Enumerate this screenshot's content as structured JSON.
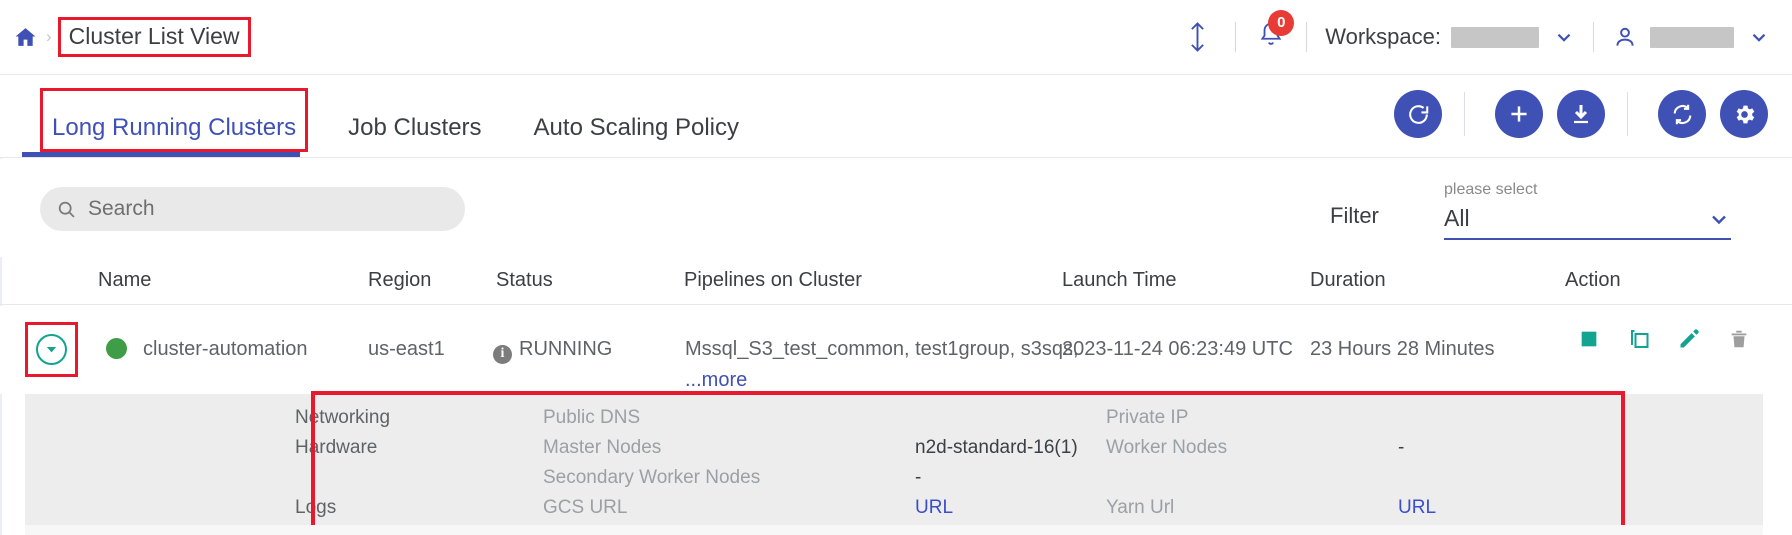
{
  "header": {
    "home_icon": "home-icon",
    "separator": "›",
    "breadcrumb_title": "Cluster List View",
    "sort_icon": "sort-vertical-icon",
    "bell_icon": "bell-icon",
    "notification_count": "0",
    "workspace_label": "Workspace:",
    "workspace_value": "",
    "user_icon": "user-icon",
    "user_value": "",
    "chevron_icon": "chevron-down-icon"
  },
  "tabs": [
    {
      "label": "Long Running Clusters",
      "active": true
    },
    {
      "label": "Job Clusters",
      "active": false
    },
    {
      "label": "Auto Scaling Policy",
      "active": false
    }
  ],
  "toolbar": {
    "buttons": [
      {
        "name": "restart-button",
        "icon": "restart-icon"
      },
      {
        "name": "add-button",
        "icon": "plus-icon"
      },
      {
        "name": "download-button",
        "icon": "download-icon"
      },
      {
        "name": "sync-button",
        "icon": "sync-icon"
      },
      {
        "name": "settings-button",
        "icon": "gear-icon"
      }
    ]
  },
  "search": {
    "icon": "search-icon",
    "placeholder": "Search",
    "value": ""
  },
  "filter": {
    "label": "Filter",
    "float_label": "please select",
    "selected": "All",
    "options": [
      "All"
    ],
    "chevron_icon": "chevron-down-icon"
  },
  "table": {
    "columns": [
      "Name",
      "Region",
      "Status",
      "Pipelines on Cluster",
      "Launch Time",
      "Duration",
      "Action"
    ],
    "rows": [
      {
        "expander_icon": "circle-chevron-down-icon",
        "status_dot": "green-status-dot",
        "name": "cluster-automation",
        "region": "us-east1",
        "status_icon": "info-icon",
        "status": "RUNNING",
        "pipelines": "Mssql_S3_test_common, test1group, s3sqs,",
        "pipelines_more": "...more",
        "launch_time": "2023-11-24 06:23:49 UTC",
        "duration": "23 Hours 28 Minutes",
        "actions": [
          {
            "name": "stop-button",
            "icon": "stop-square-icon"
          },
          {
            "name": "clone-button",
            "icon": "copy-icon"
          },
          {
            "name": "edit-button",
            "icon": "pencil-icon"
          },
          {
            "name": "delete-button",
            "icon": "trash-icon"
          }
        ]
      }
    ]
  },
  "detail_panel": {
    "rows": [
      {
        "section": "Networking",
        "label1": "Public DNS",
        "value1": "",
        "label2": "Private IP",
        "value2": ""
      },
      {
        "section": "Hardware",
        "label1": "Master Nodes",
        "value1": "n2d-standard-16(1)",
        "label2": "Worker Nodes",
        "value2": "-"
      },
      {
        "section": "",
        "label1": "Secondary Worker Nodes",
        "value1": "-",
        "label2": "",
        "value2": ""
      },
      {
        "section": "Logs",
        "label1": "GCS URL",
        "value1": "URL",
        "label2": "Yarn Url",
        "value2": "URL"
      }
    ]
  },
  "colors": {
    "primary": "#3f51b5",
    "annotation": "#e8192c",
    "teal": "#13a391",
    "status_green": "#3f9c47",
    "link": "#3b4ecc",
    "panel_bg": "#ededed"
  }
}
